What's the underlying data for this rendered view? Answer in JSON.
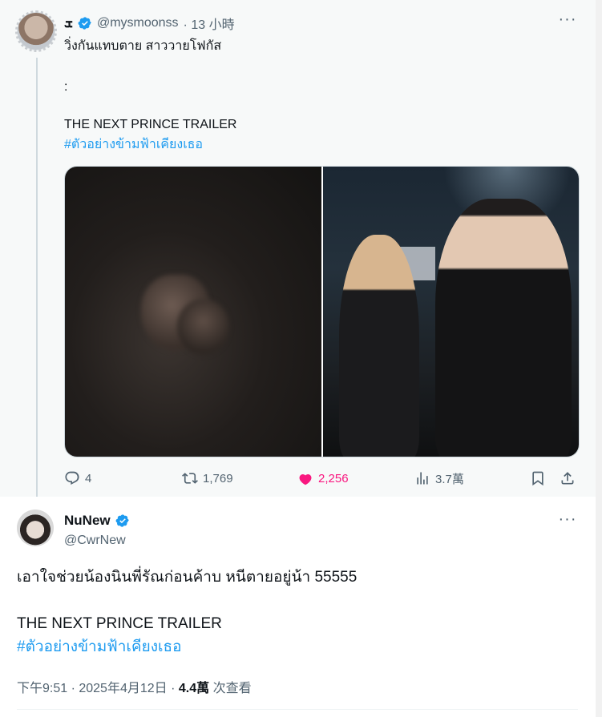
{
  "reply_tweet": {
    "display_name": "ܫ",
    "handle": "@mysmoonss",
    "time": "· 13 小時",
    "more": "···",
    "line1": "วิ่งกันแทบตาย สาววายโฟกัส",
    "line2": ":",
    "line3": "THE NEXT PRINCE TRAILER",
    "hashtag": "#ตัวอย่างข้ามฟ้าเคียงเธอ",
    "actions": {
      "replies": "4",
      "retweets": "1,769",
      "likes": "2,256",
      "views": "3.7萬"
    }
  },
  "main_tweet": {
    "display_name": "NuNew",
    "handle": "@CwrNew",
    "more": "···",
    "line1": "เอาใจช่วยน้องนินพี่รัณก่อนค้าบ หนีตายอยู่น้า 55555",
    "line2": "THE NEXT PRINCE TRAILER",
    "hashtag": "#ตัวอย่างข้ามฟ้าเคียงเธอ",
    "timestamp": "下午9:51 · 2025年4月12日 · ",
    "views_count": "4.4萬",
    "views_label": " 次查看"
  },
  "colors": {
    "accent": "#1d9bf0",
    "like": "#f91880",
    "muted": "#536471"
  }
}
